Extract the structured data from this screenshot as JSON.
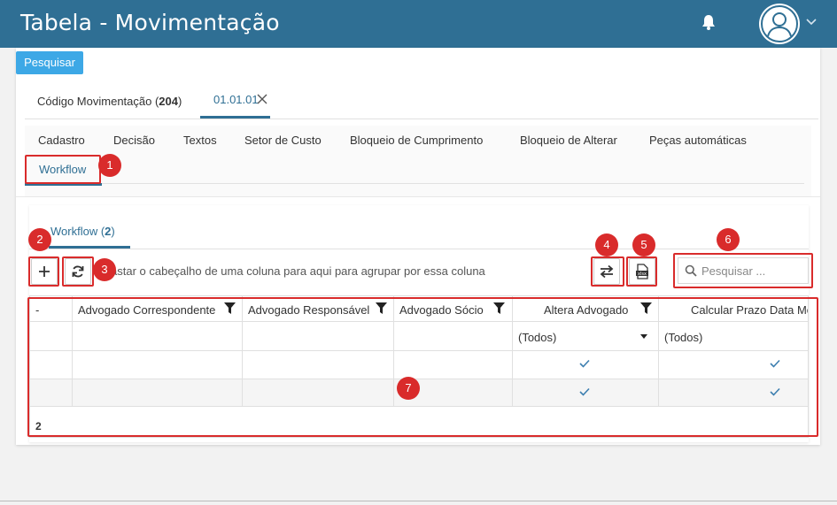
{
  "app": {
    "title": "Tabela - Movimentação"
  },
  "header": {
    "bell_icon": "bell-icon",
    "avatar_icon": "user-avatar-icon"
  },
  "toolbar": {
    "search_label": "Pesquisar"
  },
  "doc_tabs": [
    {
      "label": "Código Movimentação (",
      "count": "204",
      "suffix": ")"
    },
    {
      "label": "01.01.01",
      "active": true
    }
  ],
  "section_tabs": [
    "Cadastro",
    "Decisão",
    "Textos",
    "Setor de Custo",
    "Bloqueio de Cumprimento",
    "Bloqueio de Alterar",
    "Peças automáticas",
    "Workflow"
  ],
  "inner_tab": {
    "label": "Workflow (",
    "count": "2",
    "suffix": ")"
  },
  "grid_toolbar": {
    "group_hint": "astar o cabeçalho de uma coluna para aqui para agrupar por essa coluna",
    "search_placeholder": "Pesquisar ..."
  },
  "grid": {
    "columns": [
      "-",
      "Advogado Correspondente",
      "Advogado Responsável",
      "Advogado Sócio",
      "Altera Advogado",
      "Calcular Prazo Data Mov"
    ],
    "filters": {
      "altera": "(Todos)",
      "calcular": "(Todos)"
    },
    "rows": [
      {
        "altera": true,
        "calcular": true
      },
      {
        "altera": true,
        "calcular": true
      }
    ],
    "footer_count": "2"
  },
  "annotations": [
    "1",
    "2",
    "3",
    "4",
    "5",
    "6",
    "7"
  ],
  "colors": {
    "header": "#2f6f94",
    "primary_button": "#3da8e6",
    "annotation": "#d92b2b"
  }
}
